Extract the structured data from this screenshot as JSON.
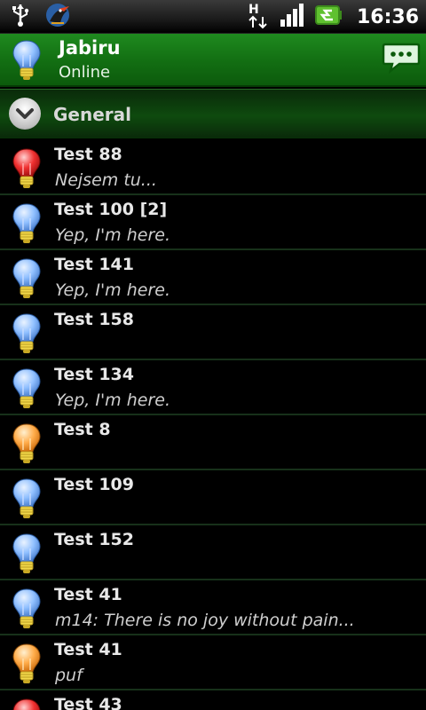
{
  "status_bar": {
    "time": "16:36",
    "network_label": "H",
    "icons": [
      "usb-icon",
      "app-bird-icon",
      "network-h-icon",
      "signal-icon",
      "battery-icon"
    ]
  },
  "account": {
    "name": "Jabiru",
    "status": "Online",
    "bulb_color": "blue",
    "chat_icon": "chat-bubble-icon"
  },
  "group": {
    "label": "General",
    "expanded": true
  },
  "contacts": [
    {
      "name": "Test 88",
      "message": "Nejsem tu...",
      "status": "red"
    },
    {
      "name": "Test 100 [2]",
      "message": "Yep, I'm here.",
      "status": "blue"
    },
    {
      "name": "Test 141",
      "message": "Yep, I'm here.",
      "status": "blue"
    },
    {
      "name": "Test 158",
      "message": "",
      "status": "blue"
    },
    {
      "name": "Test 134",
      "message": "Yep, I'm here.",
      "status": "blue"
    },
    {
      "name": "Test 8",
      "message": "",
      "status": "orange"
    },
    {
      "name": "Test 109",
      "message": "",
      "status": "blue"
    },
    {
      "name": "Test 152",
      "message": "",
      "status": "blue"
    },
    {
      "name": "Test 41",
      "message": "m14: There is no joy without pain...",
      "status": "blue"
    },
    {
      "name": "Test 41",
      "message": "puf",
      "status": "orange"
    },
    {
      "name": "Test 43",
      "message": "",
      "status": "red"
    }
  ],
  "colors": {
    "blue": "#7fb6ff",
    "orange": "#ffa54a",
    "red": "#e22a2a",
    "header_green": "#137013"
  }
}
